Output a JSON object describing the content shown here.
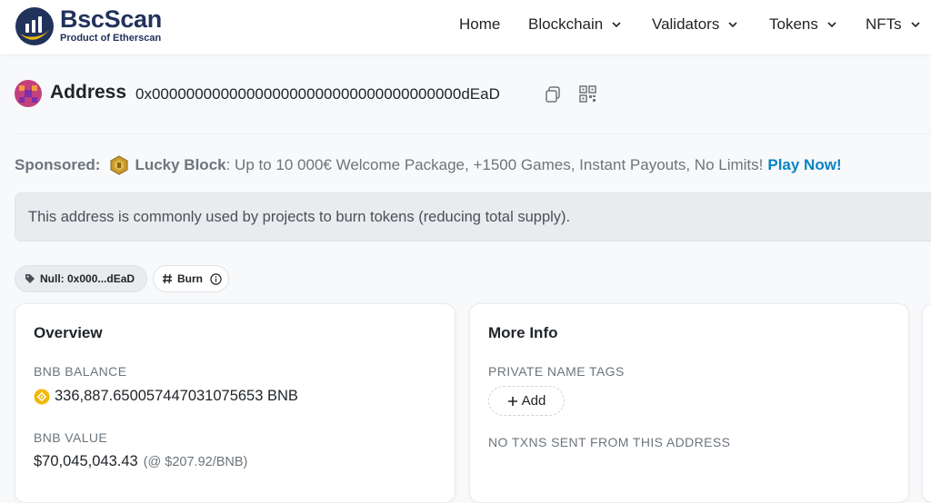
{
  "header": {
    "brand_name": "BscScan",
    "brand_sub": "Product of Etherscan",
    "nav": [
      {
        "label": "Home",
        "dropdown": false
      },
      {
        "label": "Blockchain",
        "dropdown": true
      },
      {
        "label": "Validators",
        "dropdown": true
      },
      {
        "label": "Tokens",
        "dropdown": true
      },
      {
        "label": "NFTs",
        "dropdown": true
      }
    ]
  },
  "address": {
    "label": "Address",
    "hash": "0x000000000000000000000000000000000000dEaD"
  },
  "sponsored": {
    "label": "Sponsored:",
    "brand": "Lucky Block",
    "text": ": Up to 10 000€ Welcome Package, +1500 Games, Instant Payouts, No Limits!",
    "cta": "Play Now!"
  },
  "alert": {
    "text": "This address is commonly used by projects to burn tokens (reducing total supply)."
  },
  "badges": {
    "null_label": "Null: 0x000...dEaD",
    "burn_label": "Burn"
  },
  "overview": {
    "title": "Overview",
    "balance_label": "BNB BALANCE",
    "balance_value": "336,887.650057447031075653 BNB",
    "value_label": "BNB VALUE",
    "value_amount": "$70,045,043.43",
    "value_rate": "(@ $207.92/BNB)"
  },
  "more_info": {
    "title": "More Info",
    "tags_label": "PRIVATE NAME TAGS",
    "add_label": "Add",
    "no_txns_label": "NO TXNS SENT FROM THIS ADDRESS"
  },
  "colors": {
    "brand": "#21325b",
    "accent_yellow": "#f0b90b",
    "link": "#0784c3"
  }
}
